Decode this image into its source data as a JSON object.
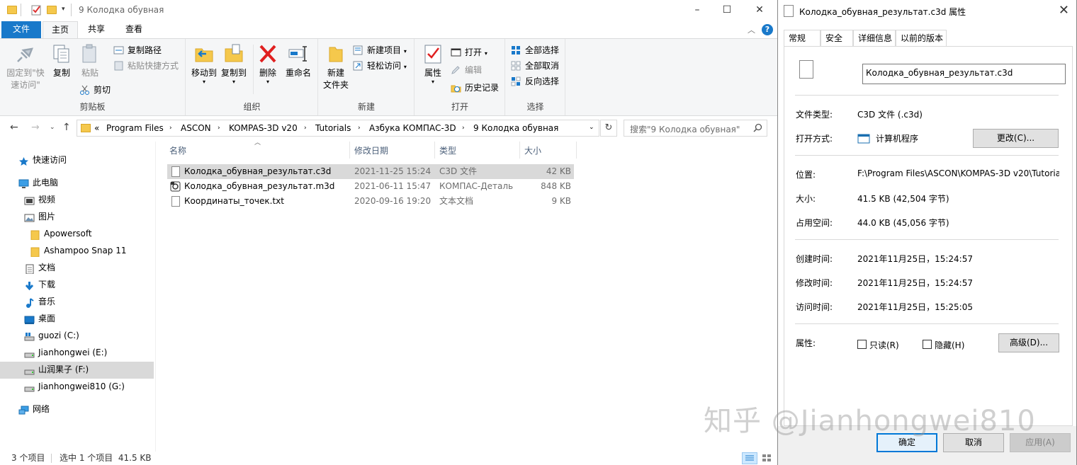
{
  "explorer": {
    "window_title": "9 Колодка обувная",
    "tabs": {
      "file": "文件",
      "home": "主页",
      "share": "共享",
      "view": "查看"
    },
    "ribbon": {
      "clipboard": {
        "label": "剪贴板",
        "pin_line1": "固定到\"快",
        "pin_line2": "速访问\"",
        "copy": "复制",
        "paste": "粘贴",
        "copy_path": "复制路径",
        "paste_shortcut": "粘贴快捷方式",
        "cut": "剪切"
      },
      "organize": {
        "label": "组织",
        "move_to": "移动到",
        "copy_to": "复制到",
        "delete": "删除",
        "rename": "重命名"
      },
      "new": {
        "label": "新建",
        "new_folder_line1": "新建",
        "new_folder_line2": "文件夹",
        "new_item": "新建项目",
        "easy_access": "轻松访问"
      },
      "open": {
        "label": "打开",
        "properties": "属性",
        "open": "打开",
        "edit": "编辑",
        "history": "历史记录"
      },
      "select": {
        "label": "选择",
        "select_all": "全部选择",
        "select_none": "全部取消",
        "invert": "反向选择"
      }
    },
    "address": {
      "prefix": "«",
      "crumbs": [
        "Program Files",
        "ASCON",
        "KOMPAS-3D v20",
        "Tutorials",
        "Азбука КОМПАС-3D",
        "9 Колодка обувная"
      ],
      "search_placeholder": "搜索\"9 Колодка обувная\""
    },
    "nav": {
      "quick_access": "快速访问",
      "this_pc": "此电脑",
      "videos": "视频",
      "pictures": "图片",
      "apowersoft": "Apowersoft",
      "ashampoo": "Ashampoo Snap 11",
      "documents": "文档",
      "downloads": "下载",
      "music": "音乐",
      "desktop": "桌面",
      "drive_c": "guozi (C:)",
      "drive_e": "Jianhongwei (E:)",
      "drive_f": "山润果子 (F:)",
      "drive_g": "Jianhongwei810 (G:)",
      "network": "网络"
    },
    "columns": {
      "name": "名称",
      "modified": "修改日期",
      "type": "类型",
      "size": "大小"
    },
    "files": [
      {
        "name": "Колодка_обувная_результат.c3d",
        "modified": "2021-11-25 15:24",
        "type": "C3D 文件",
        "size": "42 KB"
      },
      {
        "name": "Колодка_обувная_результат.m3d",
        "modified": "2021-06-11 15:47",
        "type": "КОМПАС-Деталь",
        "size": "848 KB"
      },
      {
        "name": "Координаты_точек.txt",
        "modified": "2020-09-16 19:20",
        "type": "文本文档",
        "size": "9 KB"
      }
    ],
    "status": {
      "count": "3 个项目",
      "selected": "选中 1 个项目  41.5 KB"
    }
  },
  "props": {
    "title": "Колодка_обувная_результат.c3d 属性",
    "tabs": {
      "general": "常规",
      "security": "安全",
      "details": "详细信息",
      "previous": "以前的版本"
    },
    "filename": "Колодка_обувная_результат.c3d",
    "file_type_label": "文件类型:",
    "file_type": "C3D 文件 (.c3d)",
    "opens_with_label": "打开方式:",
    "opens_with": "计算机程序",
    "change_button": "更改(C)...",
    "location_label": "位置:",
    "location": "F:\\Program Files\\ASCON\\KOMPAS-3D v20\\Tutoria",
    "size_label": "大小:",
    "size": "41.5 KB (42,504 字节)",
    "size_on_disk_label": "占用空间:",
    "size_on_disk": "44.0 KB (45,056 字节)",
    "created_label": "创建时间:",
    "created": "2021年11月25日，15:24:57",
    "modified_label": "修改时间:",
    "modified": "2021年11月25日，15:24:57",
    "accessed_label": "访问时间:",
    "accessed": "2021年11月25日，15:25:05",
    "attributes_label": "属性:",
    "readonly": "只读(R)",
    "hidden": "隐藏(H)",
    "advanced_button": "高级(D)...",
    "ok_button": "确定",
    "cancel_button": "取消",
    "apply_button": "应用(A)"
  },
  "watermark": "知乎 @Jianhongwei810",
  "colors": {
    "file_tab": "#1979ca",
    "selection": "#d9d9d9",
    "folder": "#f5c84c",
    "focus": "#0078d7"
  }
}
